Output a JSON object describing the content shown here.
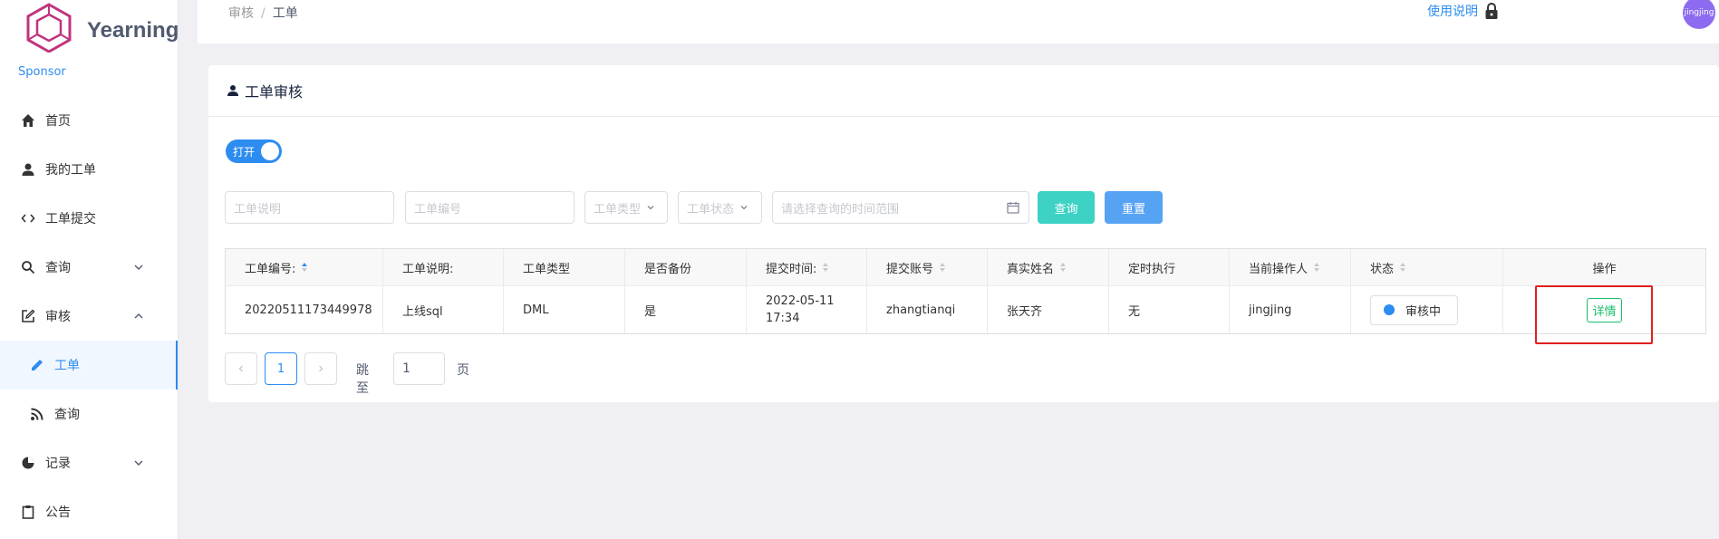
{
  "brand": {
    "name": "Yearning",
    "sponsor": "Sponsor"
  },
  "sidebar": {
    "items": [
      {
        "label": "首页",
        "icon": "home-icon"
      },
      {
        "label": "我的工单",
        "icon": "user-icon"
      },
      {
        "label": "工单提交",
        "icon": "code-icon"
      },
      {
        "label": "查询",
        "icon": "search-icon"
      },
      {
        "label": "审核",
        "icon": "edit-icon"
      },
      {
        "label": "工单",
        "icon": "pencil-icon"
      },
      {
        "label": "查询",
        "icon": "rss-icon"
      },
      {
        "label": "记录",
        "icon": "pie-chart-icon"
      },
      {
        "label": "公告",
        "icon": "clipboard-icon"
      }
    ]
  },
  "header": {
    "breadcrumb": [
      "审核",
      "工单"
    ],
    "breadcrumb_sep": "/",
    "help": "使用说明",
    "avatar_text": "jingjing"
  },
  "card": {
    "title": "工单审核"
  },
  "toggle": {
    "label": "打开"
  },
  "filters": {
    "desc_placeholder": "工单说明",
    "id_placeholder": "工单编号",
    "type_placeholder": "工单类型",
    "status_placeholder": "工单状态",
    "time_placeholder": "请选择查询的时间范围",
    "search_label": "查询",
    "reset_label": "重置"
  },
  "table": {
    "headers": [
      "工单编号:",
      "工单说明:",
      "工单类型",
      "是否备份",
      "提交时间:",
      "提交账号",
      "真实姓名",
      "定时执行",
      "当前操作人",
      "状态",
      "操作"
    ],
    "row": {
      "id": "20220511173449978",
      "desc": "上线sql",
      "type": "DML",
      "backup": "是",
      "time": "2022-05-11 17:34",
      "account": "zhangtianqi",
      "realname": "张天齐",
      "scheduled": "无",
      "operator": "jingjing",
      "status": "审核中",
      "action": "详情"
    }
  },
  "pagination": {
    "current": "1",
    "jump_label": "跳至",
    "jump_value": "1",
    "page_label": "页"
  },
  "colors": {
    "primary": "#2d8cf0",
    "success": "#19be6b",
    "teal": "#3dd2c4",
    "highlight": "#e02020"
  }
}
